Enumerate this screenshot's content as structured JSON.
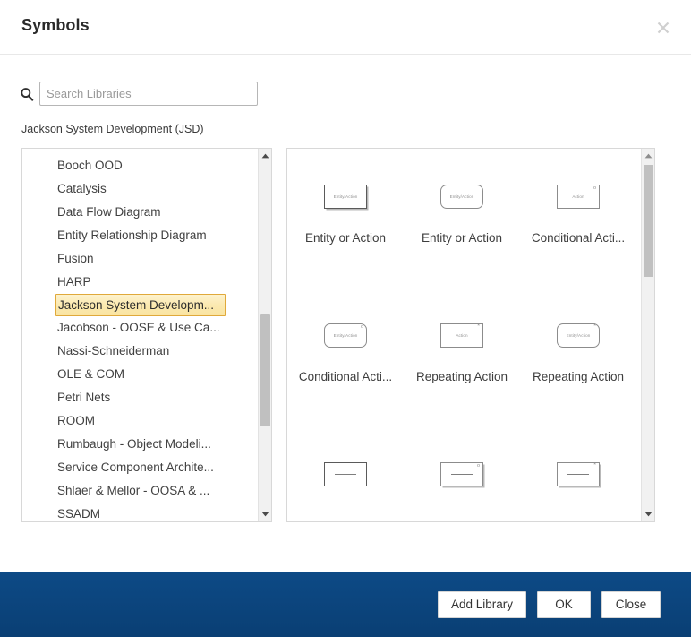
{
  "header": {
    "title": "Symbols",
    "close_icon": "close-icon"
  },
  "search": {
    "icon": "search-icon",
    "placeholder": "Search Libraries",
    "value": ""
  },
  "library_caption": "Jackson System Development (JSD)",
  "library_list": {
    "selected": "Jackson System Developm...",
    "items": [
      {
        "label": "Booch OOD",
        "selected": false
      },
      {
        "label": "Catalysis",
        "selected": false
      },
      {
        "label": "Data Flow Diagram",
        "selected": false
      },
      {
        "label": "Entity Relationship Diagram",
        "selected": false
      },
      {
        "label": "Fusion",
        "selected": false
      },
      {
        "label": "HARP",
        "selected": false
      },
      {
        "label": "Jackson System Developm...",
        "selected": true
      },
      {
        "label": "Jacobson - OOSE & Use Ca...",
        "selected": false
      },
      {
        "label": "Nassi-Schneiderman",
        "selected": false
      },
      {
        "label": "OLE & COM",
        "selected": false
      },
      {
        "label": "Petri Nets",
        "selected": false
      },
      {
        "label": "ROOM",
        "selected": false
      },
      {
        "label": "Rumbaugh - Object Modeli...",
        "selected": false
      },
      {
        "label": "Service Component Archite...",
        "selected": false
      },
      {
        "label": "Shlaer & Mellor - OOSA & ...",
        "selected": false
      },
      {
        "label": "SSADM",
        "selected": false
      }
    ]
  },
  "symbols": {
    "rows": [
      [
        {
          "label": "Entity or Action",
          "shape": "rect-shadow",
          "inner_text": "Entity/Action",
          "marker": ""
        },
        {
          "label": "Entity or Action",
          "shape": "rounded",
          "inner_text": "Entity/Action",
          "marker": ""
        },
        {
          "label": "Conditional Acti...",
          "shape": "rect",
          "inner_text": "Action",
          "marker": "o"
        }
      ],
      [
        {
          "label": "Conditional Acti...",
          "shape": "rounded",
          "inner_text": "Entity/Action",
          "marker": "o"
        },
        {
          "label": "Repeating Action",
          "shape": "rect",
          "inner_text": "Action",
          "marker": "*"
        },
        {
          "label": "Repeating Action",
          "shape": "rounded",
          "inner_text": "Entity/Action",
          "marker": "*"
        }
      ],
      [
        {
          "label": "",
          "shape": "rect-line",
          "inner_text": "",
          "marker": ""
        },
        {
          "label": "",
          "shape": "rect-line",
          "inner_text": "",
          "marker": "o"
        },
        {
          "label": "",
          "shape": "rect-line",
          "inner_text": "",
          "marker": "*"
        }
      ]
    ]
  },
  "footer": {
    "add_library_label": "Add Library",
    "ok_label": "OK",
    "close_label": "Close",
    "background_color": "#0a4178"
  },
  "colors": {
    "footer_blue": "#0a4178",
    "selection_border": "#e0a93a",
    "selection_fill": "#fbe9b0",
    "panel_border": "#d8d8d8",
    "text": "#3d3d3d"
  }
}
